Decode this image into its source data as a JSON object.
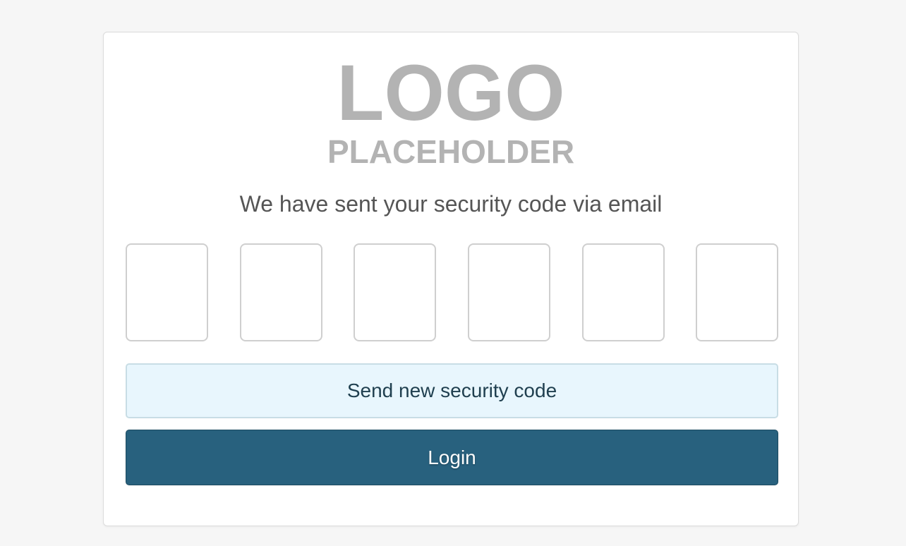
{
  "logo": {
    "line1": "LOGO",
    "line2": "PLACEHOLDER"
  },
  "message": "We have sent your security code via email",
  "code_inputs": {
    "count": 6,
    "values": [
      "",
      "",
      "",
      "",
      "",
      ""
    ]
  },
  "buttons": {
    "resend_label": "Send new security code",
    "login_label": "Login"
  },
  "colors": {
    "background": "#f6f6f6",
    "card": "#ffffff",
    "resend_bg": "#e8f6fd",
    "login_bg": "#28617e",
    "logo_gray": "#b3b3b3"
  }
}
